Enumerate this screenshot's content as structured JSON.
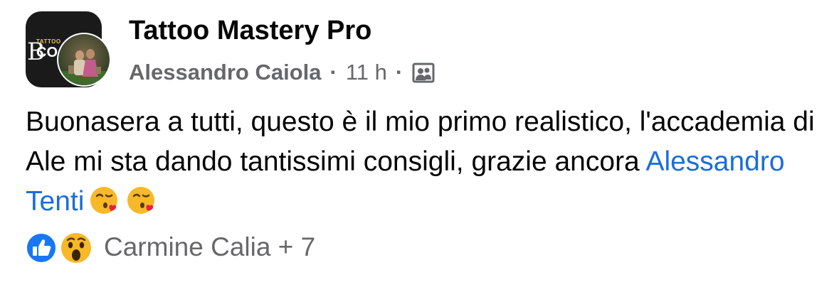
{
  "post": {
    "group_name": "Tattoo Mastery Pro",
    "author": "Alessandro Caiola",
    "separator": "·",
    "time": "11 h",
    "audience_icon": "group-members-icon",
    "avatar_logo": {
      "letter": "B",
      "tattoo_word": "TATTOO",
      "partial_word": "CO"
    },
    "body": {
      "text_before_mention": "Buonasera a tutti, questo è il mio primo realistico, l'accademia di Ale mi sta dando tantissimi consigli, grazie ancora ",
      "mention": "Alessandro Tenti",
      "emojis": [
        "face-blowing-kiss-icon",
        "face-blowing-kiss-icon"
      ]
    },
    "reactions": {
      "icons": [
        "like-reaction-icon",
        "wow-reaction-icon"
      ],
      "summary": "Carmine Calia + 7"
    }
  },
  "colors": {
    "text_primary": "#050505",
    "text_secondary": "#65676b",
    "mention_link": "#1a6ed8",
    "like_blue": "#1877f2",
    "reaction_yellow": "#f7b928"
  }
}
